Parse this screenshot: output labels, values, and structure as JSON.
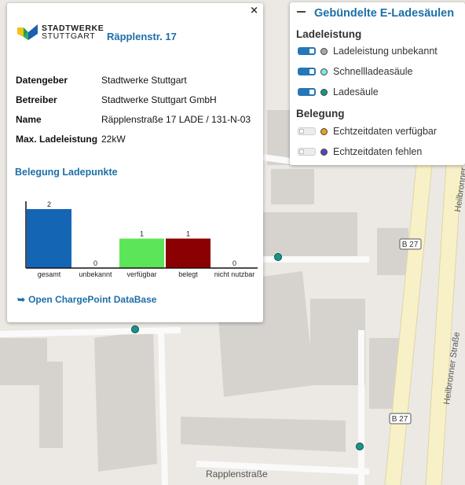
{
  "map": {
    "road_labels": [
      "Rapplenstraße",
      "Heilbronner Straße",
      "Heilbronner"
    ],
    "road_shields": [
      "B 27",
      "B 27"
    ],
    "colors": {
      "background": "#ece9e4",
      "building": "#d6d3cf",
      "road": "#fafafa",
      "main_road": "#f8f1c8",
      "marker": "#17958b"
    }
  },
  "popup": {
    "close_label": "×",
    "brand_line1": "STADTWERKE",
    "brand_line2": "STUTTGART",
    "title": "Räpplenstr. 17",
    "info": [
      {
        "key": "Datengeber",
        "value": "Stadtwerke Stuttgart"
      },
      {
        "key": "Betreiber",
        "value": "Stadtwerke Stuttgart GmbH"
      },
      {
        "key": "Name",
        "value": "Räpplenstraße 17 LADE / 131-N-03"
      },
      {
        "key": "Max. Ladeleistung",
        "value": "22kW"
      }
    ],
    "section_title": "Belegung Ladepunkte",
    "link_arrow": "➥",
    "link_label": "Open ChargePoint DataBase"
  },
  "chart_data": {
    "type": "bar",
    "title": "Belegung Ladepunkte",
    "categories": [
      "gesamt",
      "unbekannt",
      "verfügbar",
      "belegt",
      "nicht nutzbar"
    ],
    "values": [
      2,
      0,
      1,
      1,
      0
    ],
    "colors": [
      "#1565b5",
      "#1565b5",
      "#5de55a",
      "#8b0000",
      "#999999"
    ],
    "ylim": [
      0,
      2
    ],
    "grid": false,
    "legend": "none"
  },
  "legend": {
    "collapse_icon": "minus-icon",
    "title": "Gebündelte E-Ladesäulen",
    "sections": [
      {
        "title": "Ladeleistung",
        "items": [
          {
            "label": "Ladeleistung unbekannt",
            "color": "#a8a8a8",
            "enabled": true
          },
          {
            "label": "Schnellladeasäule",
            "color": "#7fe8e4",
            "enabled": true
          },
          {
            "label": "Ladesäule",
            "color": "#17958b",
            "enabled": true
          }
        ]
      },
      {
        "title": "Belegung",
        "items": [
          {
            "label": "Echtzeitdaten verfügbar",
            "color": "#e5a022",
            "enabled": false
          },
          {
            "label": "Echtzeitdaten fehlen",
            "color": "#5947b8",
            "enabled": false
          }
        ]
      }
    ]
  }
}
